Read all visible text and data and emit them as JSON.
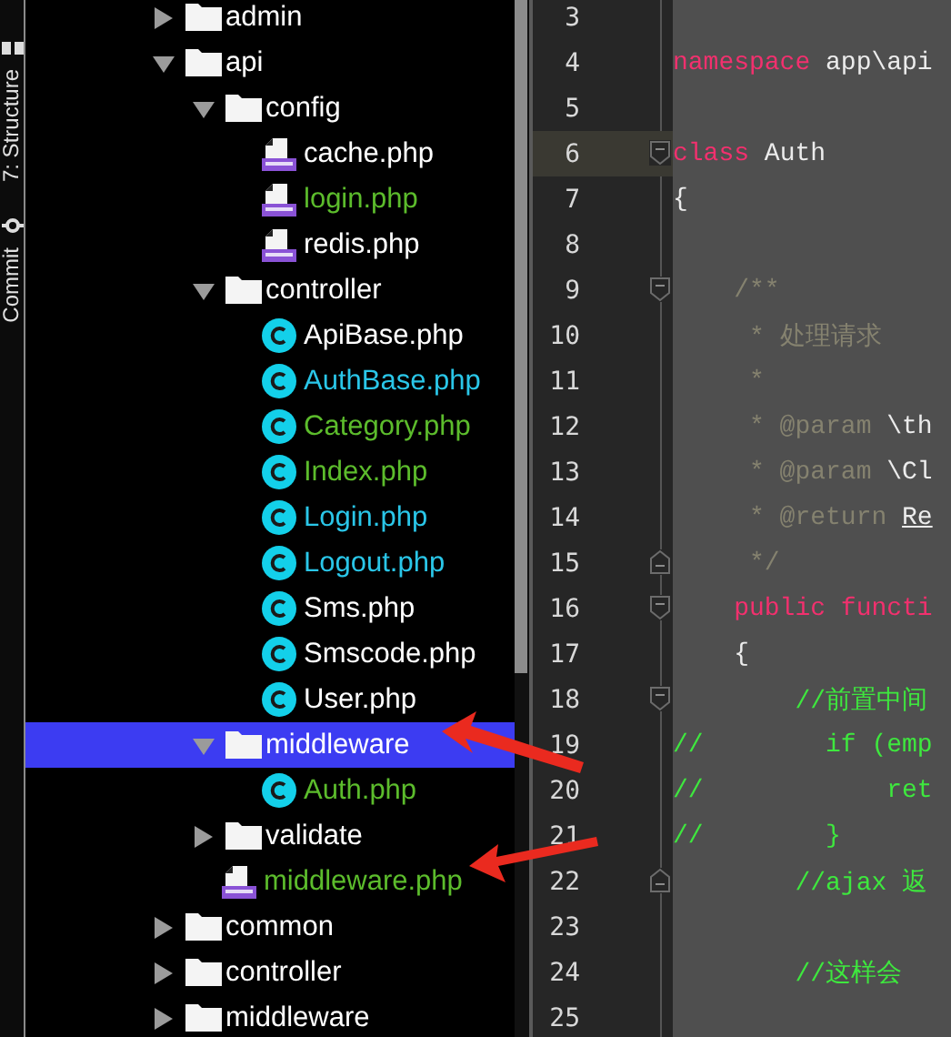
{
  "side_tabs": [
    {
      "label": "7: Structure",
      "kind": "structure"
    },
    {
      "label": "Commit",
      "kind": "commit"
    }
  ],
  "project_tree": [
    {
      "name": "admin",
      "kind": "folder",
      "expanded": false,
      "selected": false
    },
    {
      "name": "api",
      "kind": "folder",
      "expanded": true,
      "selected": false,
      "children": [
        {
          "name": "config",
          "kind": "folder",
          "expanded": true,
          "selected": false,
          "children": [
            {
              "name": "cache.php",
              "kind": "php",
              "color": "#ffffff",
              "selected": false
            },
            {
              "name": "login.php",
              "kind": "php",
              "color": "#5cbc2c",
              "selected": false
            },
            {
              "name": "redis.php",
              "kind": "php",
              "color": "#ffffff",
              "selected": false
            }
          ]
        },
        {
          "name": "controller",
          "kind": "folder",
          "expanded": true,
          "selected": false,
          "children": [
            {
              "name": "ApiBase.php",
              "kind": "class",
              "color": "#ffffff",
              "selected": false
            },
            {
              "name": "AuthBase.php",
              "kind": "class",
              "color": "#2ac6e8",
              "selected": false
            },
            {
              "name": "Category.php",
              "kind": "class",
              "color": "#5cbc2c",
              "selected": false
            },
            {
              "name": "Index.php",
              "kind": "class",
              "color": "#5cbc2c",
              "selected": false
            },
            {
              "name": "Login.php",
              "kind": "class",
              "color": "#2ac6e8",
              "selected": false
            },
            {
              "name": "Logout.php",
              "kind": "class",
              "color": "#2ac6e8",
              "selected": false
            },
            {
              "name": "Sms.php",
              "kind": "class",
              "color": "#ffffff",
              "selected": false
            },
            {
              "name": "Smscode.php",
              "kind": "class",
              "color": "#ffffff",
              "selected": false
            },
            {
              "name": "User.php",
              "kind": "class",
              "color": "#ffffff",
              "selected": false
            }
          ]
        },
        {
          "name": "middleware",
          "kind": "folder",
          "expanded": true,
          "selected": true,
          "children": [
            {
              "name": "Auth.php",
              "kind": "class",
              "color": "#5cbc2c",
              "selected": false
            }
          ]
        },
        {
          "name": "validate",
          "kind": "folder",
          "expanded": false,
          "selected": false
        },
        {
          "name": "middleware.php",
          "kind": "php",
          "color": "#5cbc2c",
          "selected": false
        }
      ]
    },
    {
      "name": "common",
      "kind": "folder",
      "expanded": false,
      "selected": false
    },
    {
      "name": "controller",
      "kind": "folder",
      "expanded": false,
      "selected": false
    },
    {
      "name": "middleware",
      "kind": "folder",
      "expanded": false,
      "selected": false
    }
  ],
  "editor": {
    "lines": [
      {
        "number": "3",
        "current": false,
        "kind": "plain"
      },
      {
        "number": "4",
        "current": false,
        "kind": "plain",
        "segments": [
          {
            "kind": "keyword",
            "text": "namespace"
          },
          {
            "kind": "plain",
            "text": " app\\api"
          }
        ]
      },
      {
        "number": "5",
        "current": false,
        "kind": "plain"
      },
      {
        "number": "6",
        "current": true,
        "kind": "fold-start",
        "segments": [
          {
            "kind": "keyword",
            "text": "class"
          },
          {
            "kind": "plain",
            "text": " Auth"
          }
        ]
      },
      {
        "number": "7",
        "current": false,
        "kind": "plain",
        "segments": [
          {
            "kind": "plain",
            "text": "{"
          }
        ]
      },
      {
        "number": "8",
        "current": false,
        "kind": "plain"
      },
      {
        "number": "9",
        "current": false,
        "kind": "fold-start",
        "segments": [
          {
            "kind": "doc",
            "text": "    /**"
          }
        ]
      },
      {
        "number": "10",
        "current": false,
        "kind": "plain",
        "segments": [
          {
            "kind": "doc",
            "text": "     * 处理请求"
          }
        ]
      },
      {
        "number": "11",
        "current": false,
        "kind": "plain",
        "segments": [
          {
            "kind": "doc",
            "text": "     *"
          }
        ]
      },
      {
        "number": "12",
        "current": false,
        "kind": "plain",
        "segments": [
          {
            "kind": "doc",
            "text": "     * @param "
          },
          {
            "kind": "plain",
            "text": "\\th"
          }
        ]
      },
      {
        "number": "13",
        "current": false,
        "kind": "plain",
        "segments": [
          {
            "kind": "doc",
            "text": "     * @param "
          },
          {
            "kind": "plain",
            "text": "\\Cl"
          }
        ]
      },
      {
        "number": "14",
        "current": false,
        "kind": "plain",
        "segments": [
          {
            "kind": "doc",
            "text": "     * @return "
          },
          {
            "kind": "link",
            "text": "Re"
          }
        ]
      },
      {
        "number": "15",
        "current": false,
        "kind": "fold-end",
        "segments": [
          {
            "kind": "doc",
            "text": "     */"
          }
        ]
      },
      {
        "number": "16",
        "current": false,
        "kind": "fold-start",
        "segments": [
          {
            "kind": "keyword",
            "text": "    public functi"
          }
        ]
      },
      {
        "number": "17",
        "current": false,
        "kind": "plain",
        "segments": [
          {
            "kind": "plain",
            "text": "    {"
          }
        ]
      },
      {
        "number": "18",
        "current": false,
        "kind": "fold-start",
        "segments": [
          {
            "kind": "comment",
            "text": "        //前置中间"
          }
        ]
      },
      {
        "number": "19",
        "current": false,
        "kind": "plain",
        "segments": [
          {
            "kind": "comment",
            "text": "//        if (emp"
          }
        ]
      },
      {
        "number": "20",
        "current": false,
        "kind": "plain",
        "segments": [
          {
            "kind": "comment",
            "text": "//            ret"
          }
        ]
      },
      {
        "number": "21",
        "current": false,
        "kind": "plain",
        "segments": [
          {
            "kind": "comment",
            "text": "//        }"
          }
        ]
      },
      {
        "number": "22",
        "current": false,
        "kind": "fold-end",
        "segments": [
          {
            "kind": "comment",
            "text": "        //ajax 返"
          }
        ]
      },
      {
        "number": "23",
        "current": false,
        "kind": "plain"
      },
      {
        "number": "24",
        "current": false,
        "kind": "plain",
        "segments": [
          {
            "kind": "comment",
            "text": "        //这样会"
          }
        ]
      },
      {
        "number": "25",
        "current": false,
        "kind": "plain"
      }
    ]
  }
}
